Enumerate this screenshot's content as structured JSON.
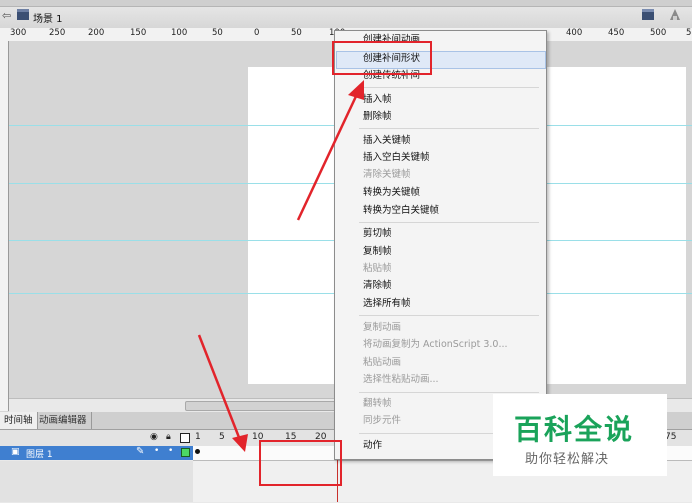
{
  "header": {
    "scene_label": "场景 1",
    "back_icon": "back-arrow-icon",
    "scene_icon": "scene-clapper-icon"
  },
  "ruler": {
    "h_labels": [
      "300",
      "250",
      "200",
      "150",
      "100",
      "50",
      "0",
      "50",
      "100",
      "400",
      "450",
      "500",
      "5"
    ]
  },
  "timeline": {
    "tabs": [
      "时间轴",
      "动画编辑器"
    ],
    "layer_name": "图层 1",
    "frame_numbers": [
      "1",
      "5",
      "10",
      "15",
      "20",
      "75"
    ]
  },
  "context_menu": {
    "items": [
      {
        "label": "创建补间动画",
        "enabled": true
      },
      {
        "label": "创建补间形状",
        "enabled": true,
        "highlighted": true
      },
      {
        "label": "创建传统补间",
        "enabled": true
      },
      {
        "label": "插入帧",
        "enabled": true
      },
      {
        "label": "删除帧",
        "enabled": true
      },
      {
        "label": "插入关键帧",
        "enabled": true
      },
      {
        "label": "插入空白关键帧",
        "enabled": true
      },
      {
        "label": "清除关键帧",
        "enabled": false
      },
      {
        "label": "转换为关键帧",
        "enabled": true
      },
      {
        "label": "转换为空白关键帧",
        "enabled": true
      },
      {
        "label": "剪切帧",
        "enabled": true
      },
      {
        "label": "复制帧",
        "enabled": true
      },
      {
        "label": "粘贴帧",
        "enabled": false
      },
      {
        "label": "清除帧",
        "enabled": true
      },
      {
        "label": "选择所有帧",
        "enabled": true
      },
      {
        "label": "复制动画",
        "enabled": false
      },
      {
        "label": "将动画复制为 ActionScript 3.0...",
        "enabled": false
      },
      {
        "label": "粘贴动画",
        "enabled": false
      },
      {
        "label": "选择性粘贴动画...",
        "enabled": false
      },
      {
        "label": "翻转帧",
        "enabled": false
      },
      {
        "label": "同步元件",
        "enabled": false
      },
      {
        "label": "动作",
        "enabled": true
      }
    ]
  },
  "watermark": {
    "title": "百科全说",
    "subtitle": "助你轻松解决"
  },
  "colors": {
    "annotation_red": "#e2242b",
    "layer_selected": "#3f7fd0",
    "watermark_green": "#1aa35a"
  }
}
